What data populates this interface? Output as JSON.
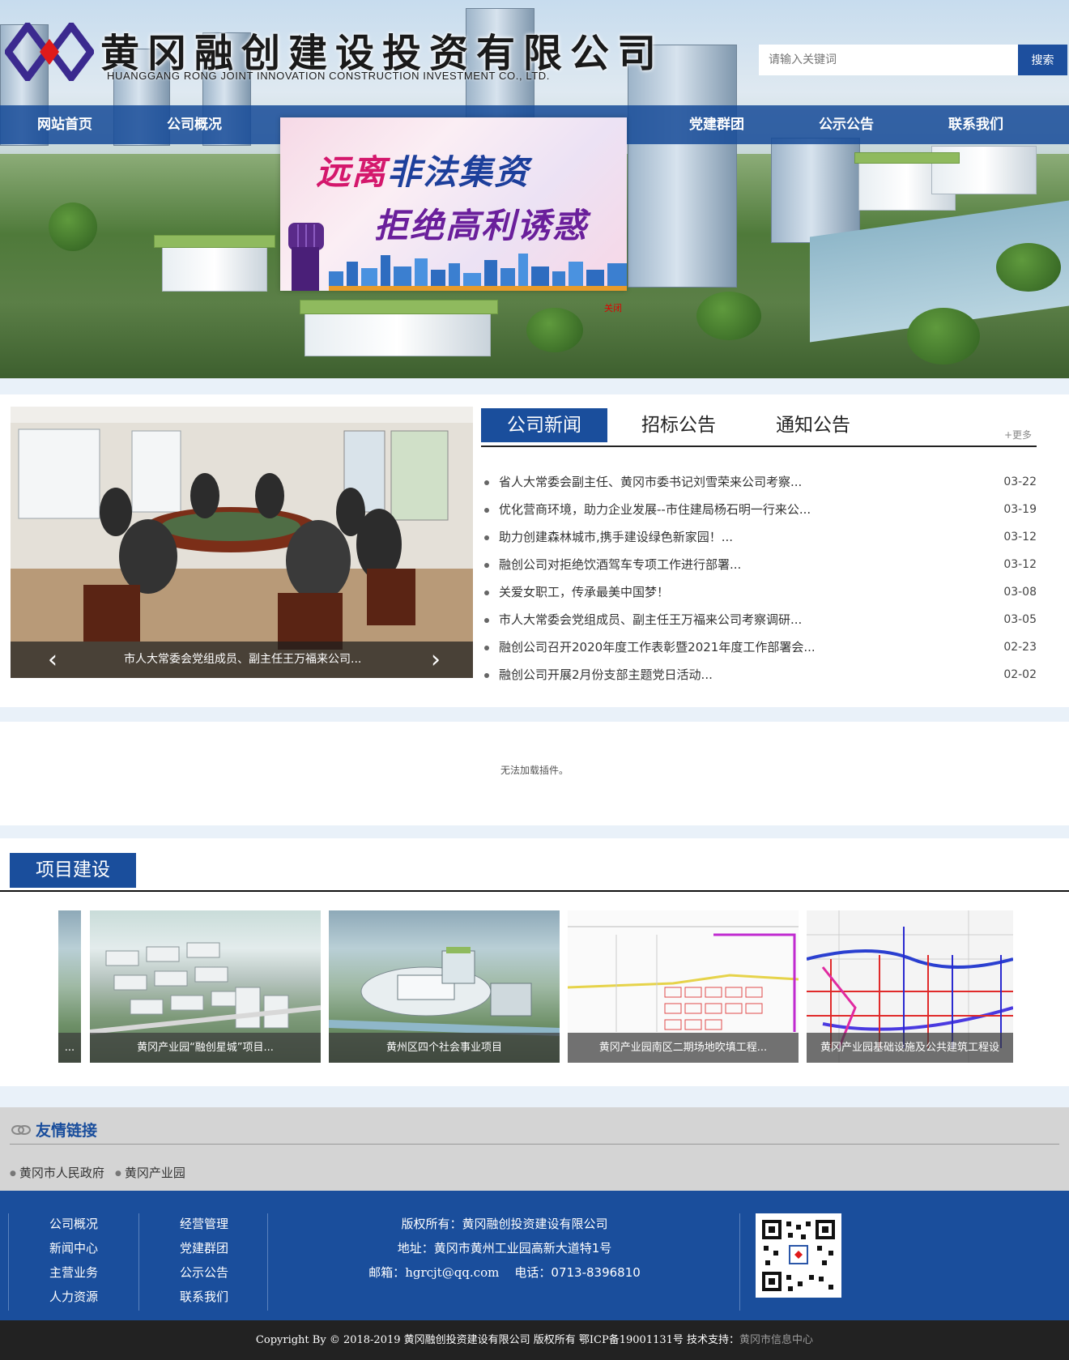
{
  "header": {
    "company_cn": "黄冈融创建设投资有限公司",
    "company_en": "HUANGGANG RONG JOINT INNOVATION CONSTRUCTION INVESTMENT CO., LTD.",
    "search_placeholder": "请输入关键词",
    "search_button": "搜索"
  },
  "nav": {
    "items": [
      {
        "label": "网站首页"
      },
      {
        "label": "公司概况"
      },
      {
        "label": "党建群团"
      },
      {
        "label": "公示公告"
      },
      {
        "label": "联系我们"
      }
    ]
  },
  "popup": {
    "line1a": "远离",
    "line1b": "非法集资",
    "line2": "拒绝高利诱惑",
    "close": "关闭"
  },
  "slider": {
    "caption": "市人大常委会党组成员、副主任王万福来公司...",
    "prev_icon": "chevron-left-icon",
    "next_icon": "chevron-right-icon"
  },
  "news": {
    "tabs": [
      {
        "label": "公司新闻",
        "active": true
      },
      {
        "label": "招标公告",
        "active": false
      },
      {
        "label": "通知公告",
        "active": false
      }
    ],
    "more": "+更多",
    "items": [
      {
        "title": "省人大常委会副主任、黄冈市委书记刘雪荣来公司考察...",
        "date": "03-22"
      },
      {
        "title": "优化营商环境，助力企业发展--市住建局杨石明一行来公...",
        "date": "03-19"
      },
      {
        "title": "助力创建森林城市,携手建设绿色新家园！...",
        "date": "03-12"
      },
      {
        "title": "融创公司对拒绝饮酒驾车专项工作进行部署...",
        "date": "03-12"
      },
      {
        "title": "关爱女职工，传承最美中国梦！",
        "date": "03-08"
      },
      {
        "title": "市人大常委会党组成员、副主任王万福来公司考察调研...",
        "date": "03-05"
      },
      {
        "title": "融创公司召开2020年度工作表彰暨2021年度工作部署会...",
        "date": "02-23"
      },
      {
        "title": "融创公司开展2月份支部主题党日活动...",
        "date": "02-02"
      }
    ]
  },
  "plugin_message": "无法加载插件。",
  "projects": {
    "title": "项目建设",
    "items": [
      {
        "caption": "..."
      },
      {
        "caption": "黄冈产业园“融创星城”项目..."
      },
      {
        "caption": "黄州区四个社会事业项目"
      },
      {
        "caption": "黄冈产业园南区二期场地吹填工程..."
      },
      {
        "caption": "黄冈产业园基础设施及公共建筑工程设"
      }
    ]
  },
  "links": {
    "title": "友情链接",
    "items": [
      {
        "label": "黄冈市人民政府"
      },
      {
        "label": "黄冈产业园"
      }
    ]
  },
  "footer": {
    "col1": [
      "公司概况",
      "新闻中心",
      "主营业务",
      "人力资源"
    ],
    "col2": [
      "经营管理",
      "党建群团",
      "公示公告",
      "联系我们"
    ],
    "owner": "版权所有：黄冈融创投资建设有限公司",
    "address": "地址：黄冈市黄州工业园高新大道特1号",
    "email_label": "邮箱：",
    "email": "hgrcjt@qq.com",
    "phone_label": "电话：",
    "phone": "0713-8396810",
    "copyright": "Copyright By © 2018-2019 黄冈融创投资建设有限公司 版权所有  鄂ICP备19001131号   技术支持：",
    "tech_support": "黄冈市信息中心"
  },
  "colors": {
    "brand_blue": "#1a4e9c",
    "popup_close": "#e00000",
    "band": "#e9f1f9"
  }
}
